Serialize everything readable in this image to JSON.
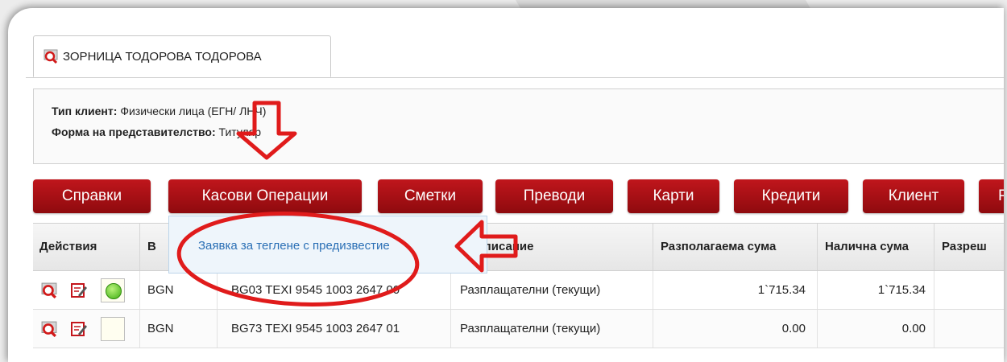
{
  "tab": {
    "label": "ЗОРНИЦА ТОДОРОВА ТОДОРОВА"
  },
  "info": {
    "client_type_key": "Тип клиент:",
    "client_type_value": "Физически лица (ЕГН/ ЛНЧ)",
    "representation_key": "Форма на представителство:",
    "representation_value": "Титуляр"
  },
  "nav": {
    "items": [
      "Справки",
      "Касови Операции",
      "Сметки",
      "Преводи",
      "Карти",
      "Кредити",
      "Клиент",
      "Р"
    ]
  },
  "dropdown": {
    "item": "Заявка за теглене с предизвестие"
  },
  "table": {
    "headers": [
      "Действия",
      "В",
      "Описание",
      "Разполагаема сума",
      "Налична сума",
      "Разреш"
    ],
    "rows": [
      {
        "currency": "BGN",
        "iban": "BG03 TEXI 9545 1003 2647 00",
        "description": "Разплащателни (текущи)",
        "available": "1`715.34",
        "balance": "1`715.34",
        "status": "active"
      },
      {
        "currency": "BGN",
        "iban": "BG73 TEXI 9545 1003 2647 01",
        "description": "Разплащателни (текущи)",
        "available": "0.00",
        "balance": "0.00",
        "status": "inactive"
      }
    ]
  },
  "colors": {
    "button_red": "#b01016",
    "link_blue": "#2a6fb5",
    "annotation_red": "#e01b1b"
  }
}
